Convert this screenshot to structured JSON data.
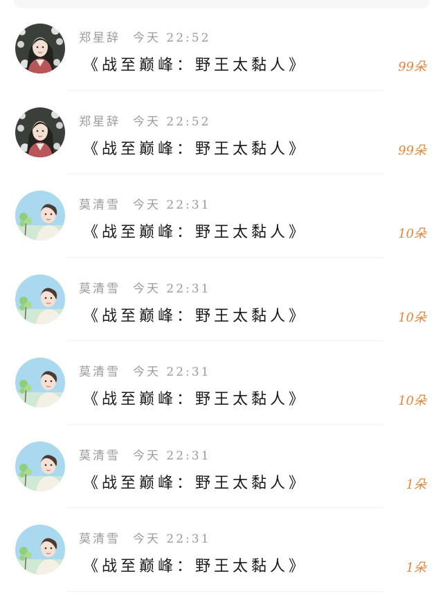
{
  "colors": {
    "count": "#e0873f",
    "meta": "#9b9b9b",
    "title": "#1a1a1a",
    "avatar_dark_bg": "#3a3f3a",
    "avatar_sky_bg": "#a9d8ef"
  },
  "records": [
    {
      "avatar": "avatar-dark-portrait-icon",
      "name": "郑星辞",
      "day": "今天",
      "time": "22:52",
      "book": "《战至巅峰：野王太黏人》",
      "count": "99朵"
    },
    {
      "avatar": "avatar-dark-portrait-icon",
      "name": "郑星辞",
      "day": "今天",
      "time": "22:52",
      "book": "《战至巅峰：野王太黏人》",
      "count": "99朵"
    },
    {
      "avatar": "avatar-sky-portrait-icon",
      "name": "莫清雪",
      "day": "今天",
      "time": "22:31",
      "book": "《战至巅峰：野王太黏人》",
      "count": "10朵"
    },
    {
      "avatar": "avatar-sky-portrait-icon",
      "name": "莫清雪",
      "day": "今天",
      "time": "22:31",
      "book": "《战至巅峰：野王太黏人》",
      "count": "10朵"
    },
    {
      "avatar": "avatar-sky-portrait-icon",
      "name": "莫清雪",
      "day": "今天",
      "time": "22:31",
      "book": "《战至巅峰：野王太黏人》",
      "count": "10朵"
    },
    {
      "avatar": "avatar-sky-portrait-icon",
      "name": "莫清雪",
      "day": "今天",
      "time": "22:31",
      "book": "《战至巅峰：野王太黏人》",
      "count": "1朵"
    },
    {
      "avatar": "avatar-sky-portrait-icon",
      "name": "莫清雪",
      "day": "今天",
      "time": "22:31",
      "book": "《战至巅峰：野王太黏人》",
      "count": "1朵"
    }
  ]
}
